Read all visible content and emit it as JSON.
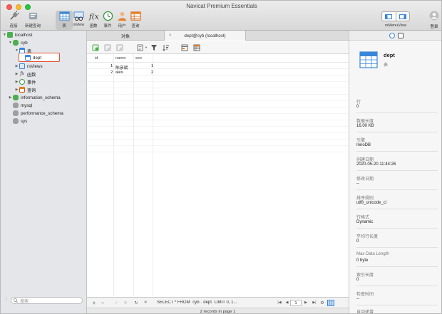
{
  "window": {
    "title": "Navicat Premium Essentials"
  },
  "toolbar": {
    "buttons": [
      {
        "id": "connect",
        "label": "连接"
      },
      {
        "id": "new-query",
        "label": "新建查询"
      },
      {
        "id": "table",
        "label": "表"
      },
      {
        "id": "view",
        "label": "rsView"
      },
      {
        "id": "function",
        "label": "函数"
      },
      {
        "id": "event",
        "label": "事件"
      },
      {
        "id": "user",
        "label": "用户"
      },
      {
        "id": "query",
        "label": "查询"
      }
    ],
    "right_toggle_label": "rsMenuView",
    "login_label": "登录"
  },
  "sidebar": {
    "tree": [
      {
        "label": "localhost",
        "level": 0,
        "expanded": true
      },
      {
        "label": "cyb",
        "level": 1,
        "expanded": true
      },
      {
        "label": "表",
        "level": 2,
        "expanded": true
      },
      {
        "label": "dept",
        "level": 3,
        "selected": true
      },
      {
        "label": "rsViews",
        "level": 2
      },
      {
        "label": "函数",
        "level": 2
      },
      {
        "label": "事件",
        "level": 2
      },
      {
        "label": "查询",
        "level": 2
      },
      {
        "label": "information_schema",
        "level": 1
      },
      {
        "label": "mysql",
        "level": 1
      },
      {
        "label": "performance_schema",
        "level": 1
      },
      {
        "label": "sys",
        "level": 1
      }
    ],
    "search_placeholder": "搜索"
  },
  "tabs": {
    "objects_label": "对象",
    "data_label": "dept@cyb (localhost)",
    "close_glyph": "×"
  },
  "grid": {
    "columns": [
      "id",
      "name",
      "sex"
    ],
    "rows": [
      [
        "1",
        "陈彦斌",
        "1"
      ],
      [
        "2",
        "ales",
        "2"
      ]
    ]
  },
  "bottom": {
    "add": "+",
    "remove": "−",
    "check": "✓",
    "cancel": "✕",
    "refresh": "↻",
    "stop": "■",
    "sql": "SELECT * FROM `cyb`.`dept` LIMIT 0, 1...",
    "first": "|◀",
    "prev": "◀",
    "page": "1",
    "next": "▶",
    "last": "▶|",
    "settings": "⚙",
    "status": "2 records in page 1"
  },
  "info": {
    "name": "dept",
    "kind": "表",
    "fields": [
      {
        "key": "行",
        "value": "0"
      },
      {
        "key": "数据长度",
        "value": "16.00 KB"
      },
      {
        "key": "引擎",
        "value": "InnoDB"
      },
      {
        "key": "创建日期",
        "value": "2020-05-20 11:44:26"
      },
      {
        "key": "修改日期",
        "value": "--"
      },
      {
        "key": "排序规则",
        "value": "utf8_unicode_ci"
      },
      {
        "key": "行格式",
        "value": "Dynamic"
      },
      {
        "key": "平均行长度",
        "value": "0"
      },
      {
        "key": "Max Data Length",
        "value": "0 byte"
      },
      {
        "key": "索引长度",
        "value": "0"
      },
      {
        "key": "检查时间",
        "value": "--"
      },
      {
        "key": "自动递增",
        "value": "1"
      }
    ]
  },
  "colors": {
    "accent": "#3a87d9",
    "selection_outline": "#e4522e",
    "db_green": "#4cae4f"
  }
}
